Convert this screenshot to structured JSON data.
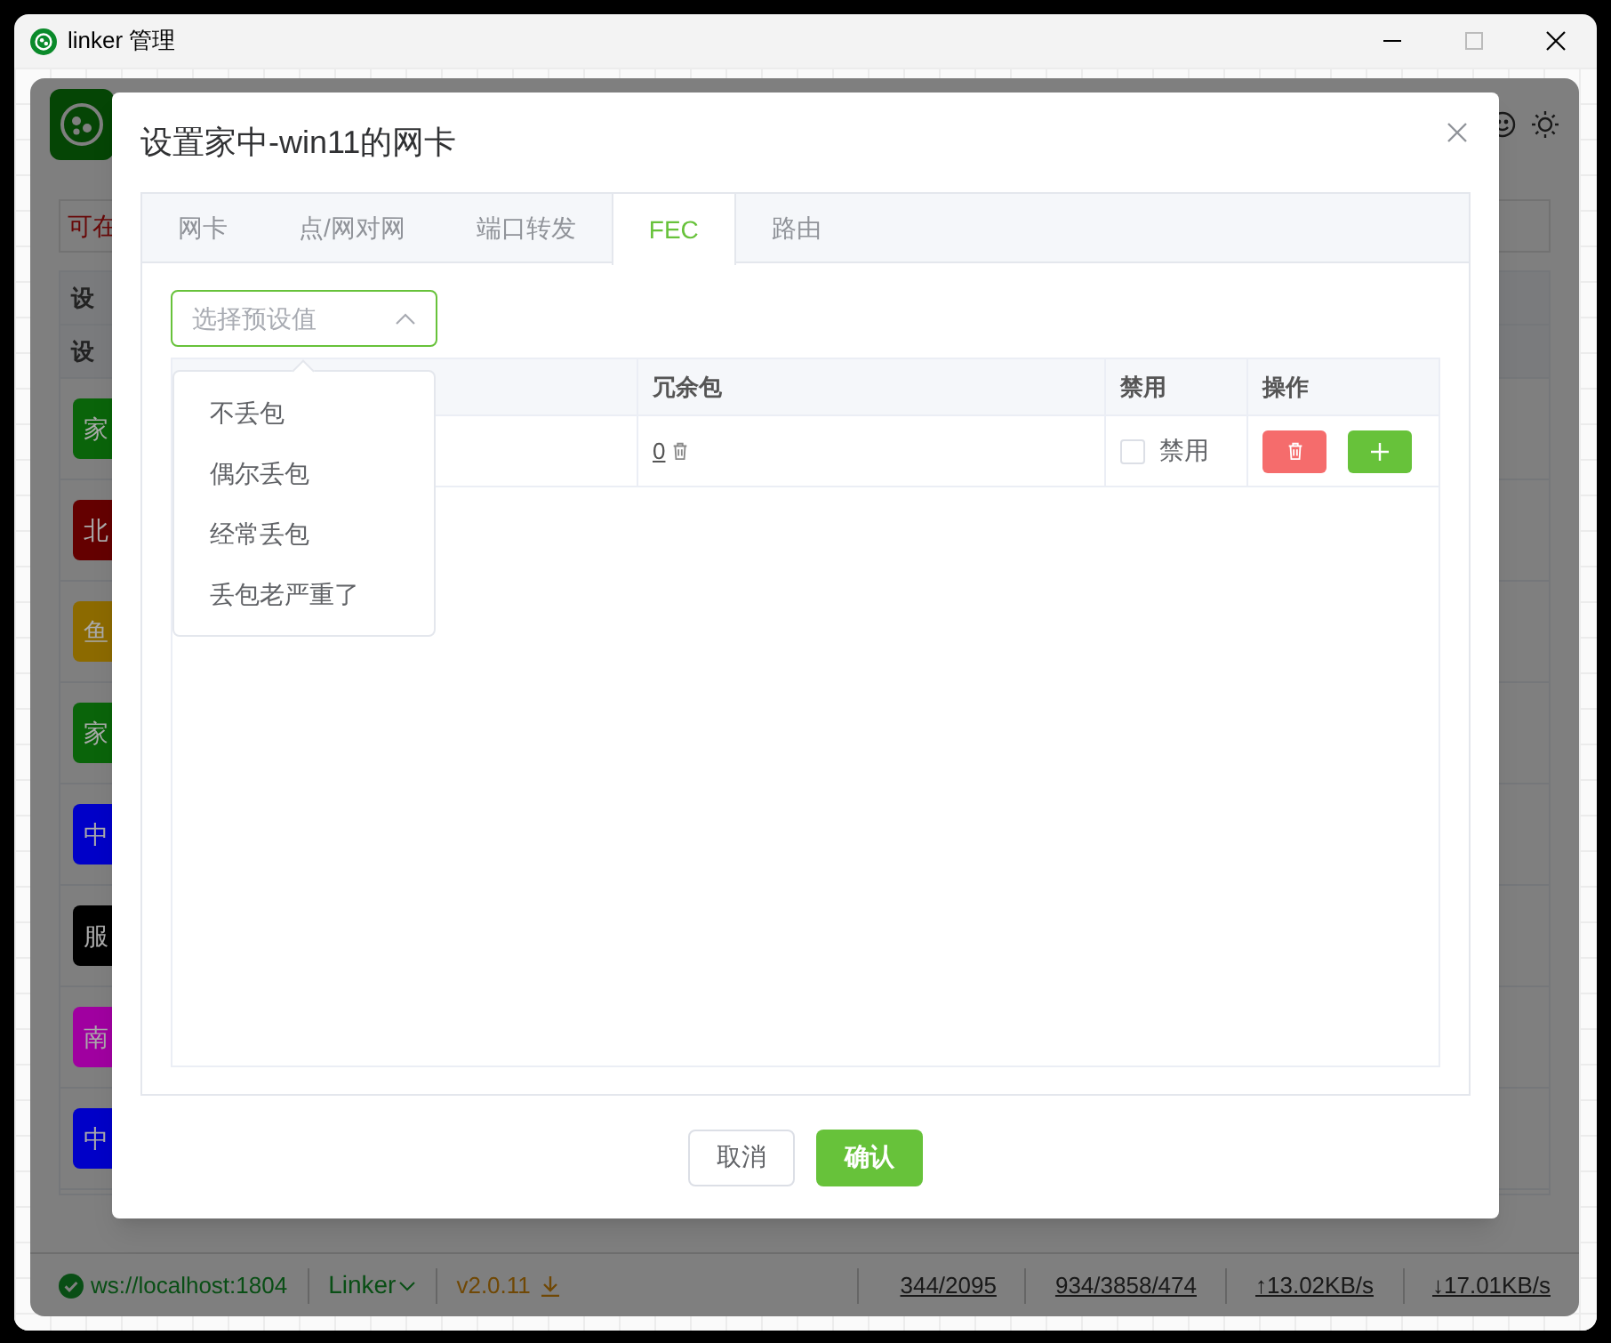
{
  "window": {
    "title": "linker 管理"
  },
  "background": {
    "notice": "可在",
    "table_headers": [
      "设",
      "设"
    ],
    "device_tags": [
      {
        "label": "家",
        "color": "#0a640a"
      },
      {
        "label": "北",
        "color": "#640000"
      },
      {
        "label": "鱼",
        "color": "#8c6a00"
      },
      {
        "label": "家",
        "color": "#0a640a"
      },
      {
        "label": "中",
        "color": "#0000c8"
      },
      {
        "label": "服",
        "color": "#000000"
      },
      {
        "label": "南",
        "color": "#a000a0"
      },
      {
        "label": "中",
        "color": "#0000c8"
      }
    ]
  },
  "status_bar": {
    "connected": true,
    "server": "ws://localhost:1804",
    "app": "Linker",
    "version": "v2.0.11",
    "counts_1": "344/2095",
    "counts_2": "934/3858/474",
    "upload": "↑13.02KB/s",
    "download": "↓17.01KB/s"
  },
  "dialog": {
    "title": "设置家中-win11的网卡",
    "tabs": [
      {
        "label": "网卡",
        "selected": false
      },
      {
        "label": "点/网对网",
        "selected": false
      },
      {
        "label": "端口转发",
        "selected": false
      },
      {
        "label": "FEC",
        "selected": true
      },
      {
        "label": "路由",
        "selected": false
      }
    ],
    "preset_select": {
      "placeholder": "选择预设值",
      "expanded": true
    },
    "preset_options": [
      "不丢包",
      "偶尔丢包",
      "经常丢包",
      "丢包老严重了"
    ],
    "table": {
      "columns": [
        "冗余包",
        "禁用",
        "操作"
      ],
      "rows": [
        {
          "redundancy": "0",
          "disabled": false,
          "disabled_label": "禁用"
        }
      ]
    },
    "buttons": [
      {
        "label": "取消",
        "kind": "default"
      },
      {
        "label": "确认",
        "kind": "primary"
      }
    ]
  }
}
